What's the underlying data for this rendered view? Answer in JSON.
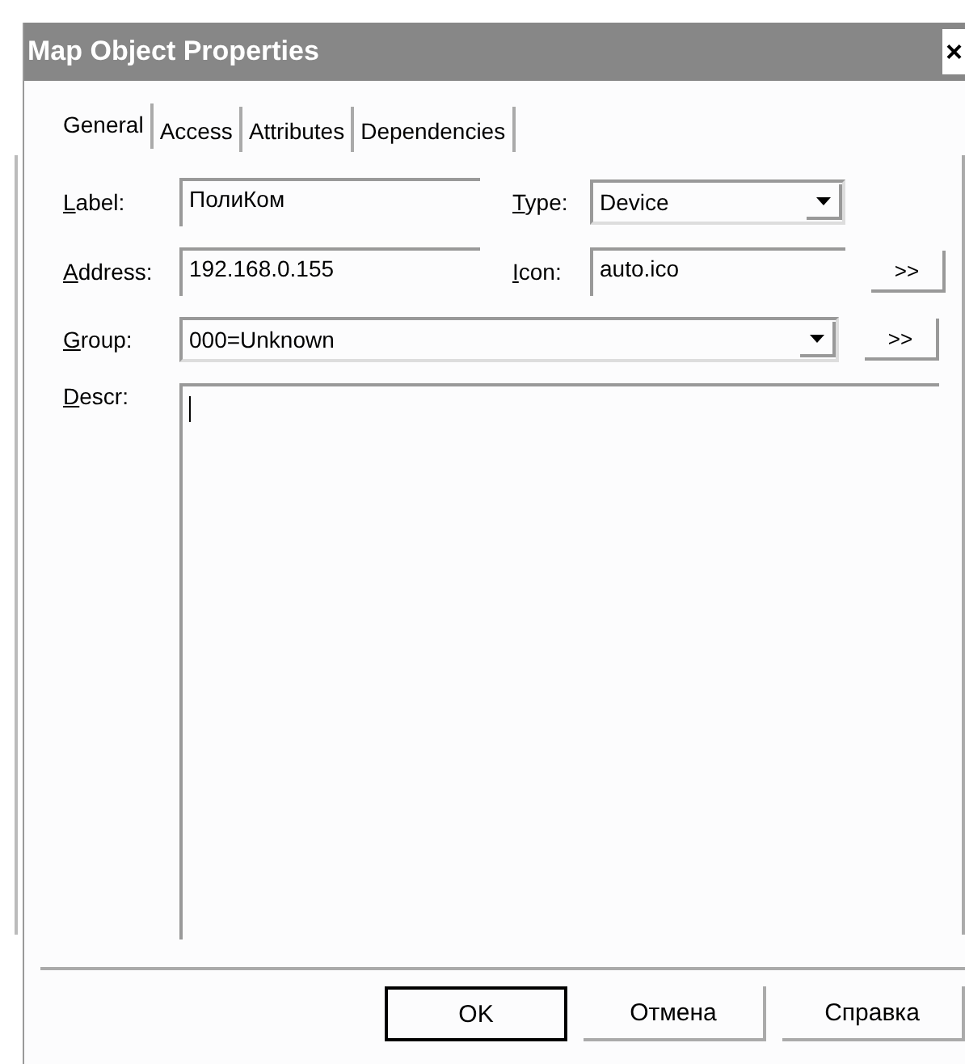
{
  "window": {
    "title": "Map Object Properties",
    "close": "×"
  },
  "tabs": [
    {
      "label": "General",
      "selected": true
    },
    {
      "label": "Access",
      "selected": false
    },
    {
      "label": "Attributes",
      "selected": false
    },
    {
      "label": "Dependencies",
      "selected": false
    }
  ],
  "fields": {
    "label": {
      "label": "Label:",
      "value": "ПолиКом"
    },
    "type": {
      "label": "Type:",
      "value": "Device"
    },
    "address": {
      "label": "Address:",
      "value": "192.168.0.155"
    },
    "icon": {
      "label": "Icon:",
      "value": "auto.ico",
      "browse": ">>"
    },
    "group": {
      "label": "Group:",
      "value": "000=Unknown",
      "browse": ">>"
    },
    "descr": {
      "label": "Descr:"
    }
  },
  "buttons": [
    {
      "label": "OK",
      "default": true
    },
    {
      "label": "Отмена",
      "default": false
    },
    {
      "label": "Справка",
      "default": false
    }
  ]
}
